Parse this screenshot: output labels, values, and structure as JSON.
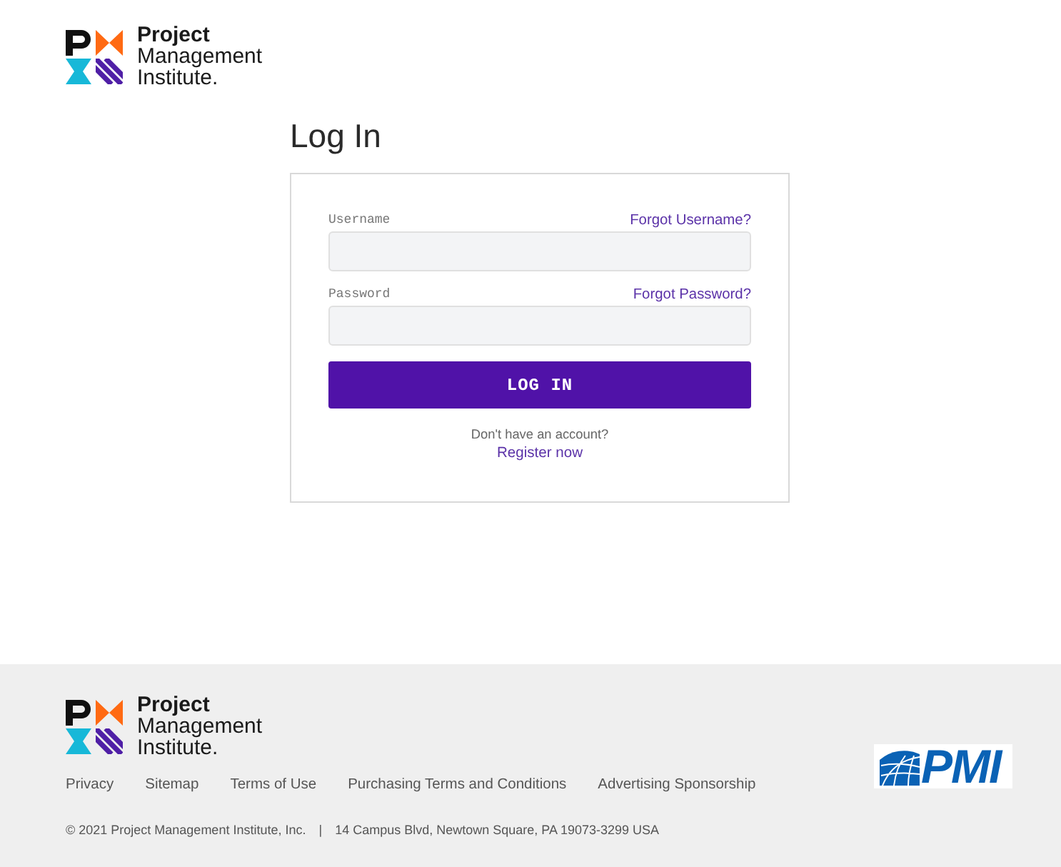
{
  "header": {
    "logo": {
      "lines": [
        "Project",
        "Management",
        "Institute."
      ]
    }
  },
  "login": {
    "title": "Log In",
    "fields": [
      {
        "label": "Username",
        "link": "Forgot Username?"
      },
      {
        "label": "Password",
        "link": "Forgot Password?"
      }
    ],
    "submit": "LOG IN",
    "signup_prompt": "Don't have an account?",
    "signup_link": "Register now"
  },
  "footer": {
    "logo": {
      "lines": [
        "Project",
        "Management",
        "Institute."
      ]
    },
    "links": [
      "Privacy",
      "Sitemap",
      "Terms of Use",
      "Purchasing Terms and Conditions",
      "Advertising Sponsorship"
    ],
    "copyright": "© 2021 Project Management Institute, Inc.",
    "separator": "|",
    "address": "14 Campus Blvd, Newtown Square, PA 19073-3299 USA",
    "brand_mark": "PMI"
  }
}
